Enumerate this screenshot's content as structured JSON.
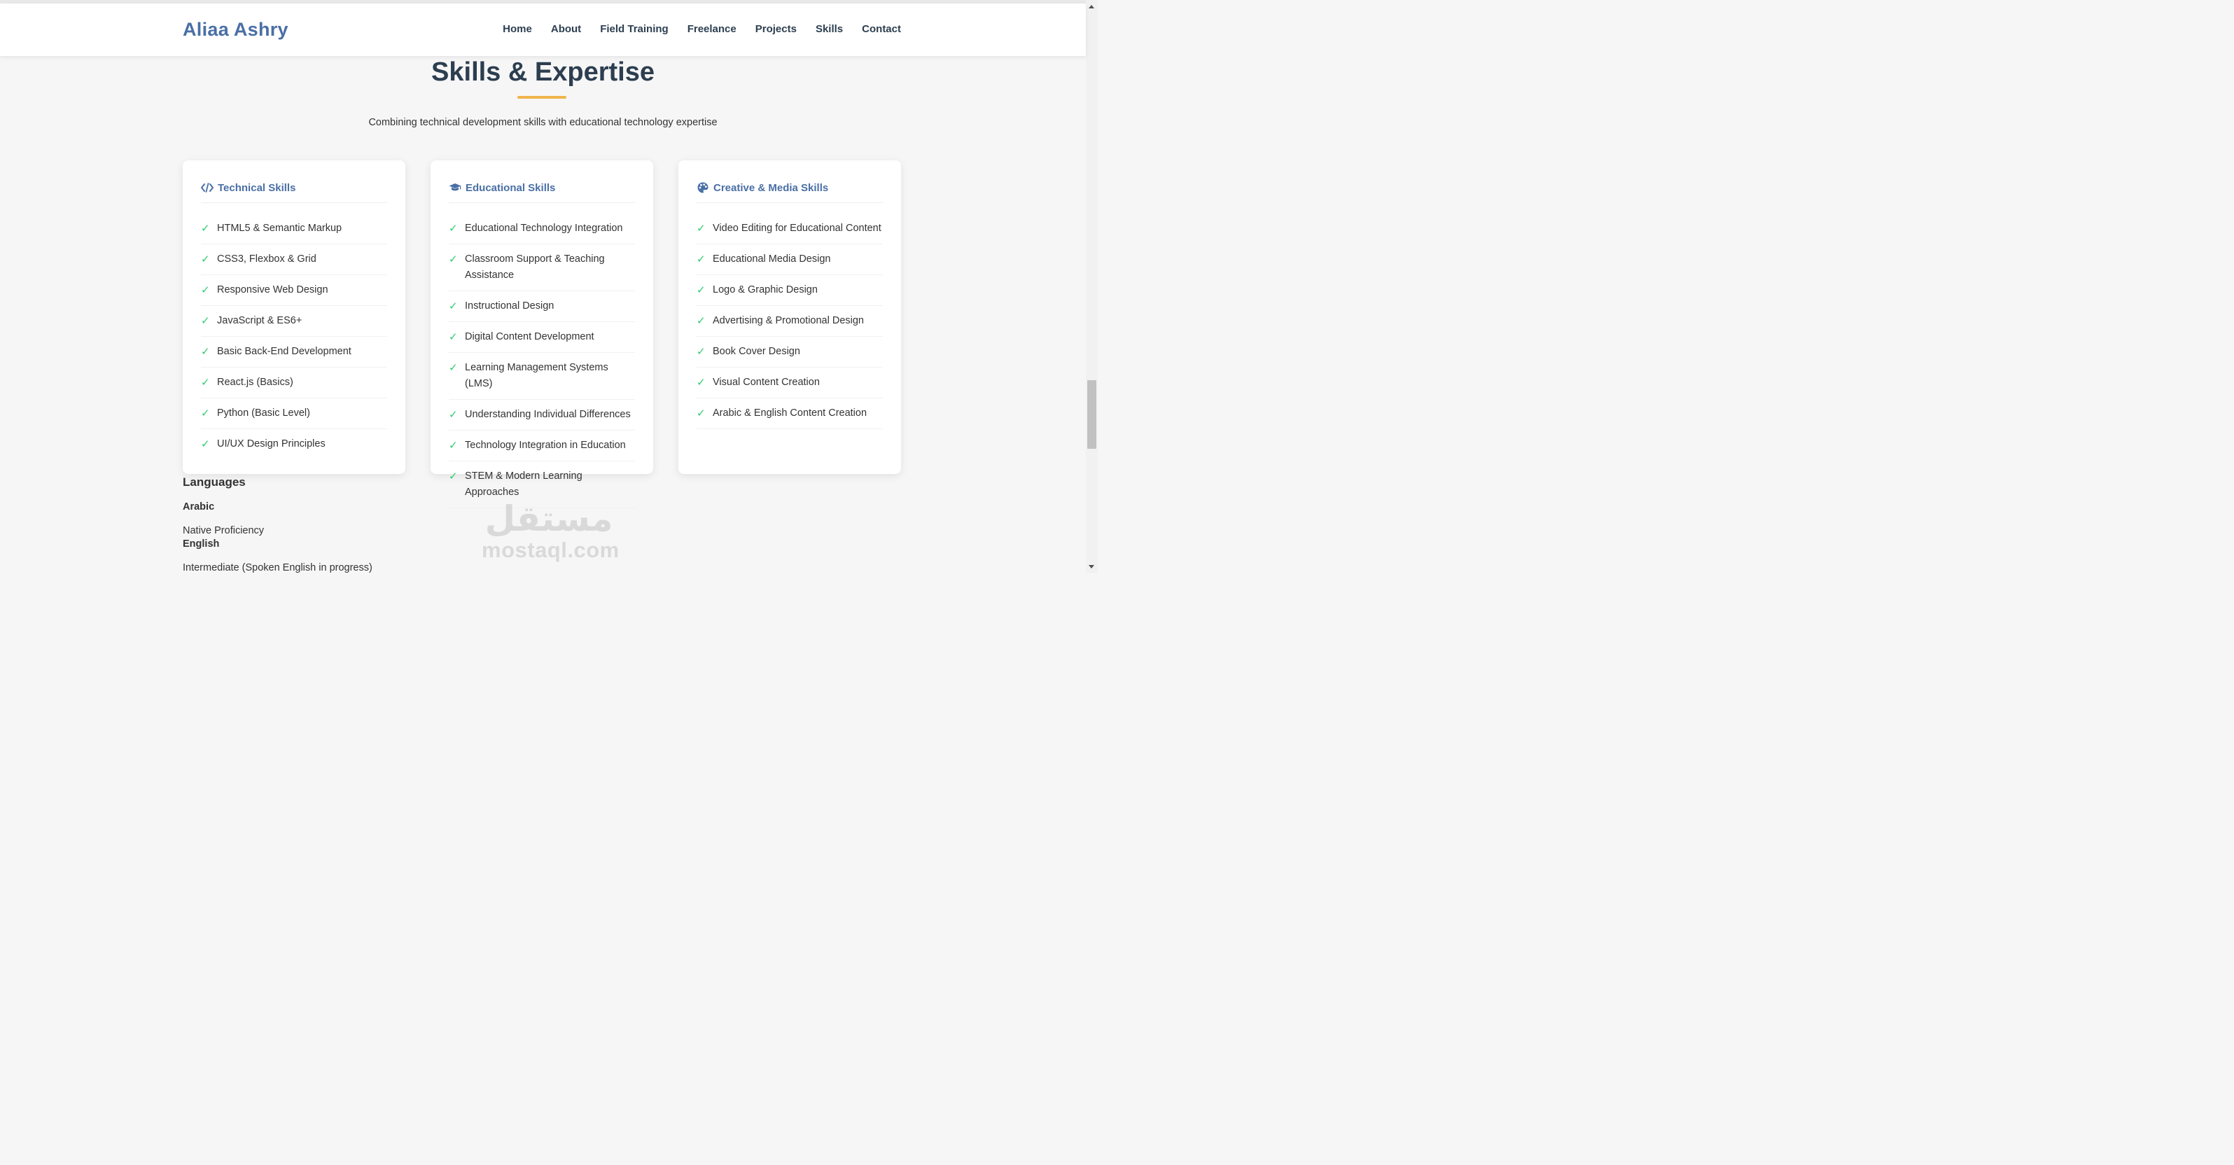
{
  "brand": "Aliaa Ashry",
  "nav": [
    "Home",
    "About",
    "Field Training",
    "Freelance",
    "Projects",
    "Skills",
    "Contact"
  ],
  "section": {
    "title": "Skills & Expertise",
    "subtitle": "Combining technical development skills with educational technology expertise",
    "accent_color": "#f0b44d"
  },
  "cards": [
    {
      "title": "Technical Skills",
      "icon": "code-icon",
      "items": [
        "HTML5 & Semantic Markup",
        "CSS3, Flexbox & Grid",
        "Responsive Web Design",
        "JavaScript & ES6+",
        "Basic Back-End Development",
        "React.js (Basics)",
        "Python (Basic Level)",
        "UI/UX Design Principles"
      ]
    },
    {
      "title": "Educational Skills",
      "icon": "graduation-cap-icon",
      "items": [
        "Educational Technology Integration",
        "Classroom Support & Teaching Assistance",
        "Instructional Design",
        "Digital Content Development",
        "Learning Management Systems (LMS)",
        "Understanding Individual Differences",
        "Technology Integration in Education",
        "STEM & Modern Learning Approaches"
      ]
    },
    {
      "title": "Creative & Media Skills",
      "icon": "palette-icon",
      "items": [
        "Video Editing for Educational Content",
        "Educational Media Design",
        "Logo & Graphic Design",
        "Advertising & Promotional Design",
        "Book Cover Design",
        "Visual Content Creation",
        "Arabic & English Content Creation"
      ]
    }
  ],
  "languages": {
    "heading": "Languages",
    "items": [
      {
        "name": "Arabic",
        "level": "Native Proficiency"
      },
      {
        "name": "English",
        "level": "Intermediate (Spoken English in progress)"
      }
    ]
  },
  "watermark": {
    "arabic": "مستقل",
    "latin": "mostaql.com"
  },
  "colors": {
    "brand": "#4a6fa5",
    "heading": "#2c3e50",
    "check": "#2ecc71",
    "background": "#f7f6f6"
  }
}
